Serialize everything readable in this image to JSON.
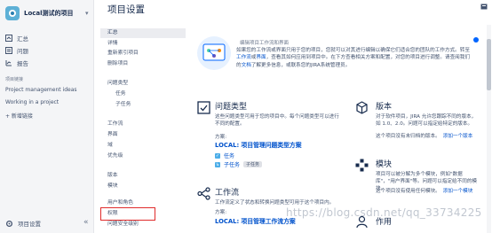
{
  "sidebar": {
    "project_name": "Local测试的项目",
    "nav": [
      {
        "label": "汇总",
        "icon": "summary-icon"
      },
      {
        "label": "问题",
        "icon": "issues-icon"
      },
      {
        "label": "报告",
        "icon": "reports-icon"
      }
    ],
    "section_label": "项目链接",
    "links": [
      "Project management ideas",
      "Working in a project"
    ],
    "add_link": "+ 新增链接",
    "footer": "项目设置"
  },
  "header": {
    "title": "项目设置"
  },
  "settings_nav": [
    {
      "label": "汇总",
      "active": true
    },
    {
      "label": "详情"
    },
    {
      "label": "重新索引项目"
    },
    {
      "label": "删除项目"
    },
    {
      "label": "问题类型"
    },
    {
      "label": "任务",
      "sub": true
    },
    {
      "label": "子任务",
      "sub": true
    },
    {
      "label": "工作流"
    },
    {
      "label": "界面"
    },
    {
      "label": "域"
    },
    {
      "label": "优先级"
    },
    {
      "label": "版本"
    },
    {
      "label": "模块"
    },
    {
      "label": "用户和角色"
    },
    {
      "label": "权限"
    },
    {
      "label": "问题安全级别"
    }
  ],
  "intro": {
    "title": "编辑项目工作流和界面",
    "text_1": "如果您的工作流或界面只用于您的项目，您就可以对其进行编辑以确保它们适合您的团队的工作方式。转至",
    "link_1": "工作流",
    "text_2": "或",
    "link_2": "界面",
    "text_3": "，查看其如何应用到项目中。在下方查看相关方案和配置，对您的项目进行调整。请查阅我们的",
    "link_3": "文档",
    "text_4": "了解更多信息，或联系您的JIRA系统管理员。"
  },
  "cards": {
    "issue_types": {
      "title": "问题类型",
      "desc": "这些问题类型可用于您的项目中。每个问题类型可以进行不同的配置。",
      "scheme_label": "方案:",
      "scheme": "LOCAL: 项目管理问题类型方案",
      "types": [
        {
          "label": "任务",
          "badge": ""
        },
        {
          "label": "子任务",
          "badge": "子任务"
        }
      ]
    },
    "versions": {
      "title": "版本",
      "desc": "对于软件项目，JIRA 允许您跟踪不同的版本，如 1.0、2.0。问题可以指定给特定的版本。",
      "note": "这个项目没有未归档的版本。",
      "add": "添加一个版本"
    },
    "workflow": {
      "title": "工作流",
      "desc": "工作流定义了状态和转换问题类型可用于这个项目内。",
      "scheme_label": "方案:",
      "scheme": "LOCAL: 项目管理工作流方案"
    },
    "modules": {
      "title": "模块",
      "desc": "项目可以被分解为多个模块，例如\"数据库\"，\"用户界面\"等。问题可以指定给不同的模块。",
      "note": "这个项目没有使用任何模块。",
      "add": "添加一个模块"
    },
    "roles": {
      "title": "作用"
    }
  },
  "watermark": "https://blog.csdn.net/qq_33734225",
  "colors": {
    "accent": "#0052cc",
    "highlight_border": "#e02b2b",
    "avatar": "#5db0d6"
  }
}
